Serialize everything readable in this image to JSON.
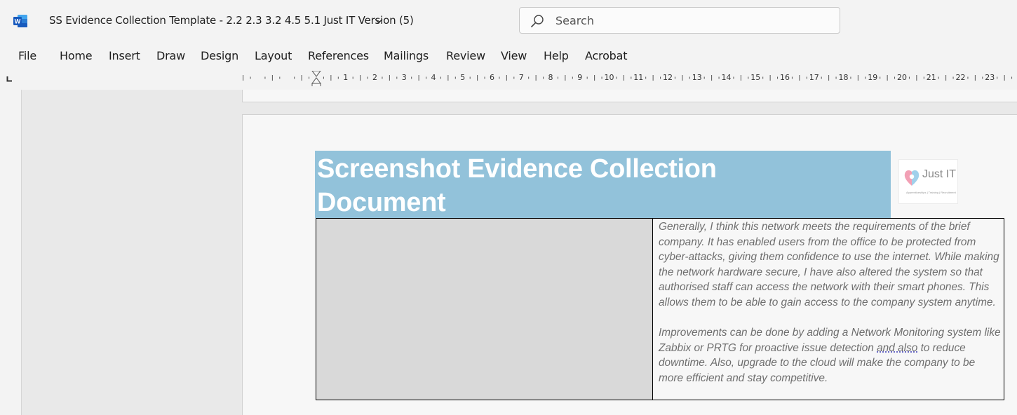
{
  "app": {
    "icon": "word-icon",
    "document_title": "SS Evidence Collection Template - 2.2 2.3 3.2 4.5 5.1 Just IT Version (5)",
    "brand_color": "#185abd"
  },
  "search": {
    "placeholder": "Search"
  },
  "menu": {
    "items": [
      "File",
      "Home",
      "Insert",
      "Draw",
      "Design",
      "Layout",
      "References",
      "Mailings",
      "Review",
      "View",
      "Help",
      "Acrobat"
    ]
  },
  "ruler": {
    "labels": [
      "1",
      "2",
      "3",
      "4",
      "5",
      "6",
      "7",
      "8",
      "9",
      "10",
      "11",
      "12",
      "13",
      "14",
      "15",
      "16",
      "17",
      "18",
      "19",
      "20",
      "21",
      "22",
      "23"
    ]
  },
  "document": {
    "banner_line1": "Screenshot Evidence Collection",
    "banner_line2": "Document",
    "banner_color": "#92c2da",
    "logo_text": "Just IT",
    "logo_subtext": "Apprenticeships | Training | Recruitment",
    "paragraph1": "Generally, I think this network meets the requirements of the brief company. It has enabled users from the office to be protected from cyber-attacks, giving them confidence to use the internet. While making the network hardware secure, I have also altered the system so that authorised staff can access the network with their smart phones. This allows them to be able to gain access to the company system anytime.",
    "paragraph2_before": "Improvements can be done by adding a Network Monitoring system like Zabbix or PRTG for proactive issue detection ",
    "paragraph2_flagged": "and also",
    "paragraph2_after": " to reduce downtime. Also, upgrade to the cloud will make the company to be more efficient and stay competitive."
  }
}
